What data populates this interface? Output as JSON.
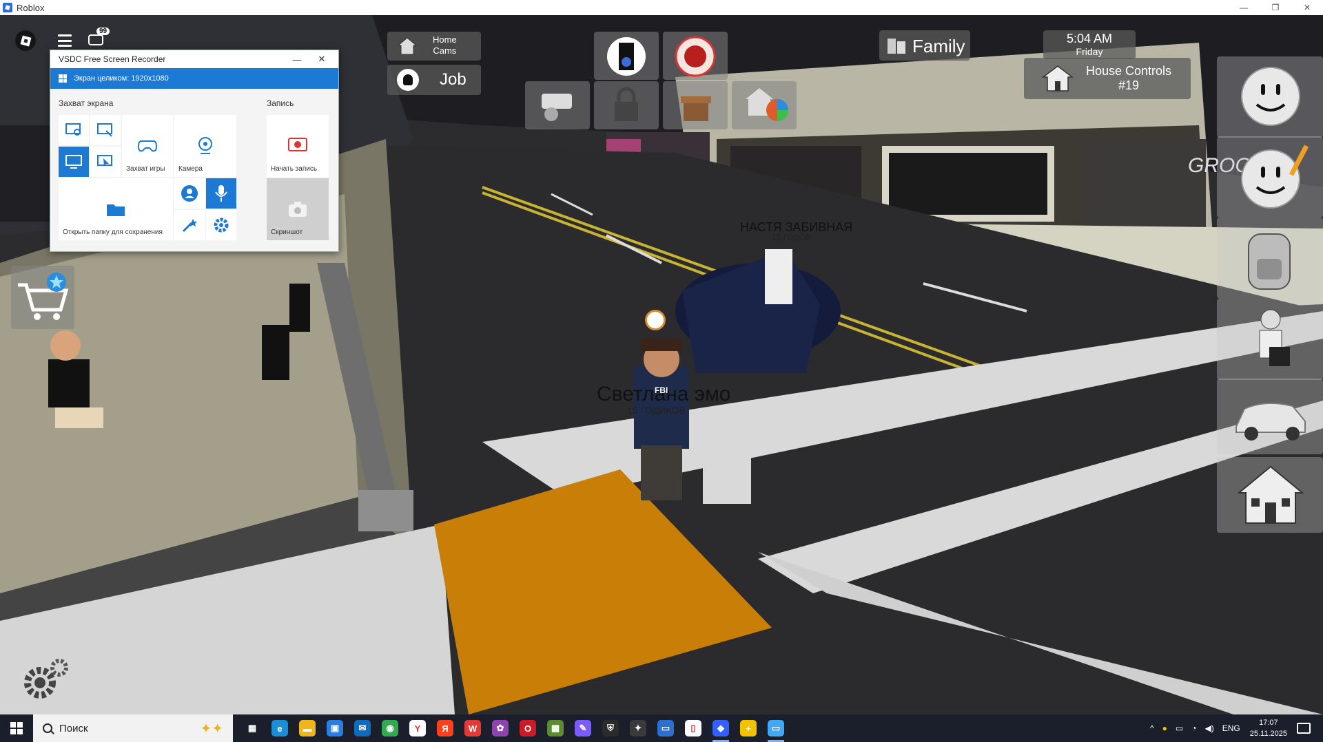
{
  "window": {
    "title": "Roblox",
    "controls": [
      "—",
      "❐",
      "✕"
    ]
  },
  "roblox_ui": {
    "chat_badge": "99"
  },
  "vsdc": {
    "title": "VSDC Free Screen Recorder",
    "mode_label": "Экран целиком: 1920x1080",
    "section_capture": "Захват экрана",
    "section_record": "Запись",
    "tile_game": "Захват игры",
    "tile_camera": "Камера",
    "tile_start": "Начать запись",
    "tile_folder": "Открыть папку для сохранения",
    "tile_screenshot": "Скриншот",
    "win_min": "—",
    "win_close": "✕"
  },
  "hud": {
    "home_cams": "Home\nCams",
    "job": "Job",
    "family": "Family",
    "time": "5:04 AM",
    "day": "Friday",
    "house_controls": "House Controls",
    "house_number": "#19",
    "store_sign": "GROC"
  },
  "players": {
    "player1_name": "НАСТЯ ЗАБИВНАЯ",
    "player1_sub": "15 ГОДОВ",
    "player2_name": "Светлана эмо",
    "player2_sub": "15 ГОДИКОВ",
    "player2_badge": "FBI"
  },
  "taskbar": {
    "search_placeholder": "Поиск",
    "lang": "ENG",
    "time": "17:07",
    "date": "25.11.2025",
    "apps": [
      {
        "name": "task-view",
        "color": "#1a1f2b",
        "glyph": "▦"
      },
      {
        "name": "edge",
        "color": "#1b8fd6",
        "glyph": "e"
      },
      {
        "name": "explorer",
        "color": "#f1b51c",
        "glyph": "▬"
      },
      {
        "name": "store",
        "color": "#2a7de1",
        "glyph": "▣"
      },
      {
        "name": "outlook",
        "color": "#0f6cbd",
        "glyph": "✉"
      },
      {
        "name": "chrome",
        "color": "#34a853",
        "glyph": "◉"
      },
      {
        "name": "yandex-browser",
        "color": "#ffffff",
        "glyph": "Y"
      },
      {
        "name": "yandex",
        "color": "#fc3f1d",
        "glyph": "Я"
      },
      {
        "name": "wps",
        "color": "#e53935",
        "glyph": "W"
      },
      {
        "name": "photos",
        "color": "#8e44ad",
        "glyph": "✿"
      },
      {
        "name": "opera",
        "color": "#cc1b24",
        "glyph": "O"
      },
      {
        "name": "minecraft",
        "color": "#5b8c32",
        "glyph": "▩"
      },
      {
        "name": "paint",
        "color": "#7a5cff",
        "glyph": "✎"
      },
      {
        "name": "game-shield",
        "color": "#2b2b2b",
        "glyph": "⛨"
      },
      {
        "name": "game-star",
        "color": "#3a3a3a",
        "glyph": "✦"
      },
      {
        "name": "vsdc-app",
        "color": "#2b6fd0",
        "glyph": "▭"
      },
      {
        "name": "notes",
        "color": "#ffffff",
        "glyph": "▯"
      },
      {
        "name": "roblox",
        "color": "#335fff",
        "glyph": "◆"
      },
      {
        "name": "plus-app",
        "color": "#f2c200",
        "glyph": "+"
      },
      {
        "name": "vsdc-recorder",
        "color": "#3fa9f5",
        "glyph": "▭"
      }
    ]
  }
}
